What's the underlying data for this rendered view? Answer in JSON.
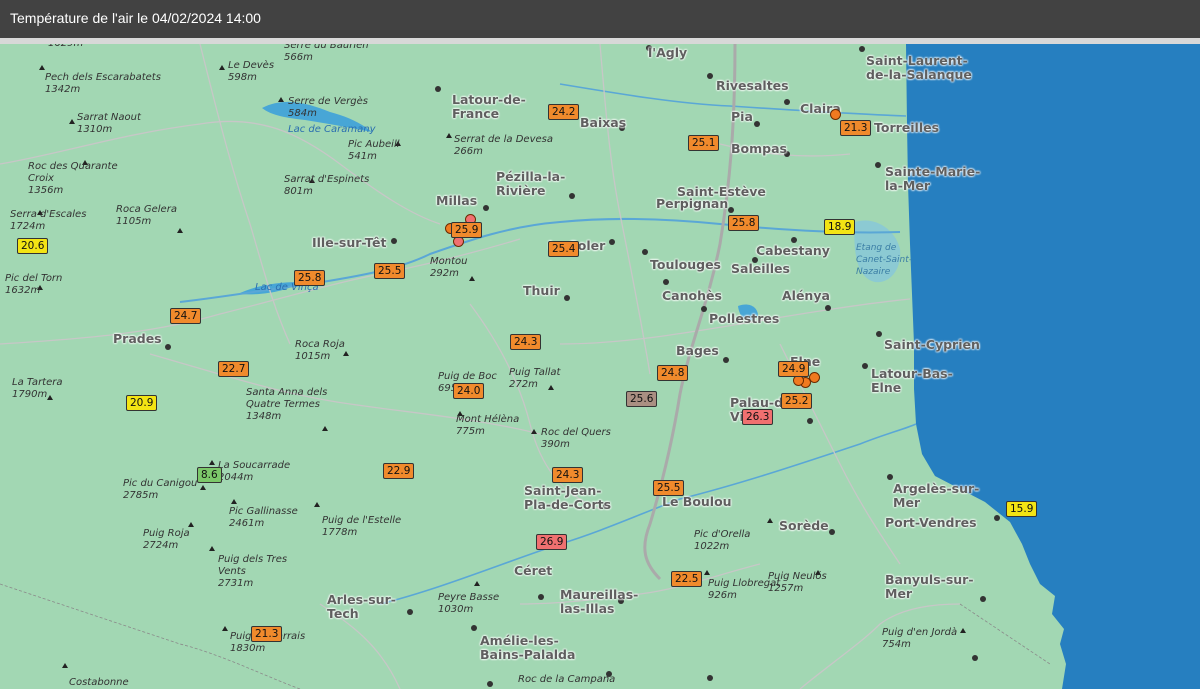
{
  "header": {
    "title": "Température de l'air le 04/02/2024 14:00"
  },
  "colors": {
    "land": "#a2d7b3",
    "sea": "#267fc0",
    "header": "#424242",
    "orange": "#f08a2c",
    "yellow": "#f3e414",
    "green": "#7cc86a",
    "red": "#f07070",
    "grey": "#aa8f82"
  },
  "towns": [
    {
      "id": "lagly",
      "text": "l'Agly"
    },
    {
      "id": "saint-laurent",
      "text": "Saint-Laurent-\nde-la-Salanque"
    },
    {
      "id": "rivesaltes",
      "text": "Rivesaltes"
    },
    {
      "id": "latour-de-france",
      "text": "Latour-de-\nFrance"
    },
    {
      "id": "claira",
      "text": "Claira"
    },
    {
      "id": "baixas",
      "text": "Baixas"
    },
    {
      "id": "pia",
      "text": "Pia"
    },
    {
      "id": "torreilles",
      "text": "Torreilles"
    },
    {
      "id": "bompas",
      "text": "Bompas"
    },
    {
      "id": "sainte-marie",
      "text": "Sainte-Marie-\nla-Mer"
    },
    {
      "id": "pezilla",
      "text": "Pézilla-la-\nRivière"
    },
    {
      "id": "saint-esteve",
      "text": "Saint-Estève"
    },
    {
      "id": "perpignan",
      "text": "Perpignan"
    },
    {
      "id": "millas",
      "text": "Millas"
    },
    {
      "id": "ille-sur-tet",
      "text": "Ille-sur-Têt"
    },
    {
      "id": "le-soler",
      "text": "Le Soler"
    },
    {
      "id": "cabestany",
      "text": "Cabestany"
    },
    {
      "id": "toulouges",
      "text": "Toulouges"
    },
    {
      "id": "saleilles",
      "text": "Saleilles"
    },
    {
      "id": "thuir",
      "text": "Thuir"
    },
    {
      "id": "canohes",
      "text": "Canohès"
    },
    {
      "id": "alenya",
      "text": "Alénya"
    },
    {
      "id": "prades",
      "text": "Prades"
    },
    {
      "id": "pollestres",
      "text": "Pollestres"
    },
    {
      "id": "saint-cyprien",
      "text": "Saint-Cyprien"
    },
    {
      "id": "bages",
      "text": "Bages"
    },
    {
      "id": "elne",
      "text": "Elne"
    },
    {
      "id": "latour-bas-elne",
      "text": "Latour-Bas-\nElne"
    },
    {
      "id": "palau",
      "text": "Palau-del-\nVidre"
    },
    {
      "id": "saint-jean",
      "text": "Saint-Jean-\nPla-de-Corts"
    },
    {
      "id": "le-boulou",
      "text": "Le Boulou"
    },
    {
      "id": "argeles",
      "text": "Argelès-sur-\nMer"
    },
    {
      "id": "sorede",
      "text": "Sorède"
    },
    {
      "id": "port-vendres",
      "text": "Port-Vendres"
    },
    {
      "id": "ceret",
      "text": "Céret"
    },
    {
      "id": "maureillas",
      "text": "Maureillas-\nlas-Illas"
    },
    {
      "id": "banyuls",
      "text": "Banyuls-sur-\nMer"
    },
    {
      "id": "arles-sur-tech",
      "text": "Arles-sur-\nTech"
    },
    {
      "id": "amelie",
      "text": "Amélie-les-\nBains-Palalda"
    }
  ],
  "peaks": [
    {
      "id": "top-cut",
      "text": "1629m"
    },
    {
      "id": "serre-baurien",
      "text": "Serre du Baurien\n566m"
    },
    {
      "id": "pech-escarabatets",
      "text": "Pech dels Escarabatets\n1342m"
    },
    {
      "id": "le-deves",
      "text": "Le Devès\n598m"
    },
    {
      "id": "serre-verges",
      "text": "Serre de Vergès\n584m"
    },
    {
      "id": "sarrat-naout",
      "text": "Sarrat Naout\n1310m"
    },
    {
      "id": "serrat-devesa",
      "text": "Serrat de la Devesa\n266m"
    },
    {
      "id": "pic-aubeill",
      "text": "Pic Aubeill\n541m"
    },
    {
      "id": "roc-quarante",
      "text": "Roc des Quarante\nCroix\n1356m"
    },
    {
      "id": "sarrat-espinets",
      "text": "Sarrat d'Espinets\n801m"
    },
    {
      "id": "serra-escales",
      "text": "Serra d'Escales\n1724m"
    },
    {
      "id": "roca-gelera",
      "text": "Roca Gelera\n1105m"
    },
    {
      "id": "montou",
      "text": "Montou\n292m"
    },
    {
      "id": "pic-torn",
      "text": "Pic del Torn\n1632m"
    },
    {
      "id": "roca-roja",
      "text": "Roca Roja\n1015m"
    },
    {
      "id": "la-tartera",
      "text": "La Tartera\n1790m"
    },
    {
      "id": "puig-boc",
      "text": "Puig de Boc\n695m"
    },
    {
      "id": "puig-tallat",
      "text": "Puig Tallat\n272m"
    },
    {
      "id": "santa-anna",
      "text": "Santa Anna dels\nQuatre Termes\n1348m"
    },
    {
      "id": "mont-helena",
      "text": "Mont Hélèna\n775m"
    },
    {
      "id": "roc-quers",
      "text": "Roc del Quers\n390m"
    },
    {
      "id": "la-soucarrade",
      "text": "La Soucarrade\n2044m"
    },
    {
      "id": "pic-canigou",
      "text": "Pic du Canigou\n2785m"
    },
    {
      "id": "pic-gallinasse",
      "text": "Pic Gallinasse\n2461m"
    },
    {
      "id": "puig-estelle",
      "text": "Puig de l'Estelle\n1778m"
    },
    {
      "id": "pic-orella",
      "text": "Pic d'Orella\n1022m"
    },
    {
      "id": "puig-roja",
      "text": "Puig Roja\n2724m"
    },
    {
      "id": "puig-tres-vents",
      "text": "Puig dels Tres\nVents\n2731m"
    },
    {
      "id": "puig-llobregat",
      "text": "Puig Llobregat\n926m"
    },
    {
      "id": "puig-neulos",
      "text": "Puig Neulós\n1257m"
    },
    {
      "id": "peyre-basse",
      "text": "Peyre Basse\n1030m"
    },
    {
      "id": "puig-sarrais",
      "text": "Puig de Sarrais\n1830m"
    },
    {
      "id": "puig-jorda",
      "text": "Puig d'en Jordà\n754m"
    },
    {
      "id": "costabonne",
      "text": "Costabonne"
    },
    {
      "id": "roc-campana",
      "text": "Roc de la Campana"
    }
  ],
  "lakes": [
    {
      "id": "caramany",
      "text": "Lac de Caramany"
    },
    {
      "id": "vinca",
      "text": "Lac de Vinça"
    },
    {
      "id": "canet",
      "text": "Etang de\nCanet-Saint-\nNazaire"
    }
  ],
  "readings": [
    {
      "id": "r1",
      "value": "24.2",
      "level": "orange"
    },
    {
      "id": "r2",
      "value": "25.1",
      "level": "orange"
    },
    {
      "id": "r3",
      "value": "21.3",
      "level": "orange"
    },
    {
      "id": "r4",
      "value": "25.9",
      "level": "orange"
    },
    {
      "id": "r5",
      "value": "25.8",
      "level": "orange"
    },
    {
      "id": "r6",
      "value": "18.9",
      "level": "yellow"
    },
    {
      "id": "r7",
      "value": "25.4",
      "level": "orange"
    },
    {
      "id": "r8",
      "value": "20.6",
      "level": "yellow"
    },
    {
      "id": "r9",
      "value": "25.5",
      "level": "orange"
    },
    {
      "id": "r10",
      "value": "25.8",
      "level": "orange"
    },
    {
      "id": "r11",
      "value": "24.7",
      "level": "orange"
    },
    {
      "id": "r12",
      "value": "24.3",
      "level": "orange"
    },
    {
      "id": "r13",
      "value": "22.7",
      "level": "orange"
    },
    {
      "id": "r14",
      "value": "24.0",
      "level": "orange"
    },
    {
      "id": "r15",
      "value": "24.8",
      "level": "orange"
    },
    {
      "id": "r16",
      "value": "24.9",
      "level": "orange"
    },
    {
      "id": "r17",
      "value": "20.9",
      "level": "yellow"
    },
    {
      "id": "r18",
      "value": "25.6",
      "level": "grey"
    },
    {
      "id": "r19",
      "value": "25.2",
      "level": "orange"
    },
    {
      "id": "r20",
      "value": "26.3",
      "level": "red"
    },
    {
      "id": "r21",
      "value": "22.9",
      "level": "orange"
    },
    {
      "id": "r22",
      "value": "8.6",
      "level": "green"
    },
    {
      "id": "r23",
      "value": "24.3",
      "level": "orange"
    },
    {
      "id": "r24",
      "value": "25.5",
      "level": "orange"
    },
    {
      "id": "r25",
      "value": "15.9",
      "level": "yellow"
    },
    {
      "id": "r26",
      "value": "26.9",
      "level": "red"
    },
    {
      "id": "r27",
      "value": "22.5",
      "level": "orange"
    },
    {
      "id": "r28",
      "value": "21.3",
      "level": "orange"
    }
  ]
}
